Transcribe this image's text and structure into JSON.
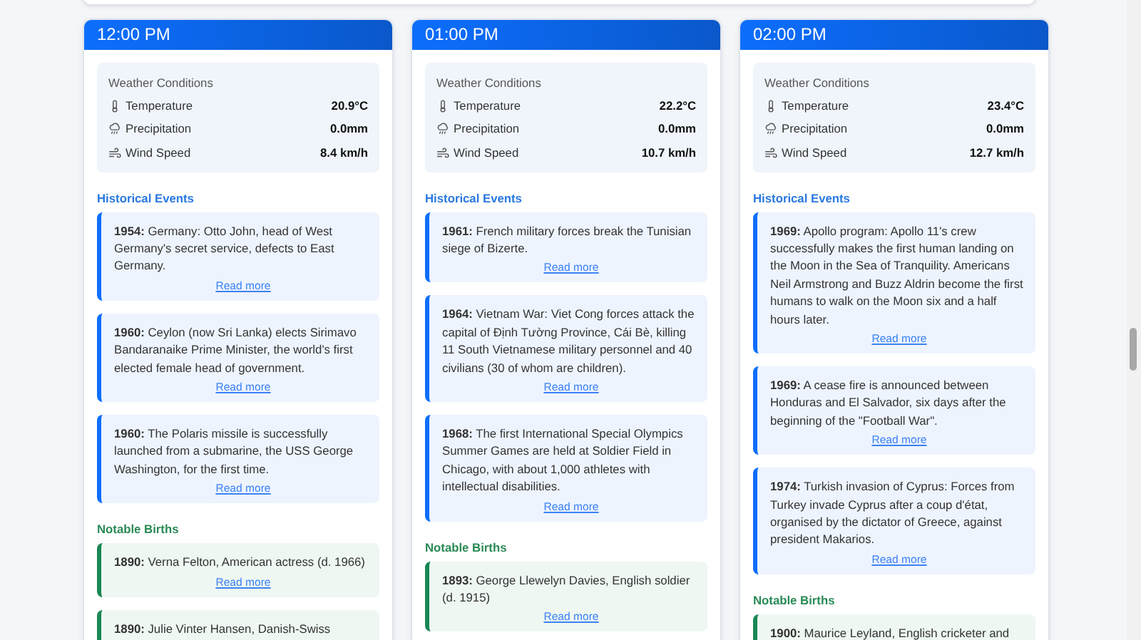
{
  "hours": [
    {
      "time": "12:00 PM",
      "weather": {
        "title": "Weather Conditions",
        "rows": [
          {
            "kind": "temperature",
            "label": "Temperature",
            "value": "20.9°C"
          },
          {
            "kind": "precipitation",
            "label": "Precipitation",
            "value": "0.0mm"
          },
          {
            "kind": "wind",
            "label": "Wind Speed",
            "value": "8.4 km/h"
          }
        ]
      },
      "sections": [
        {
          "kind": "events",
          "title": "Historical Events",
          "items": [
            {
              "text": "**1954:** Germany: Otto John, head of West Germany's secret service, defects to East Germany.",
              "link": "Read more"
            },
            {
              "text": "**1960:** Ceylon (now Sri Lanka) elects Sirimavo Bandaranaike Prime Minister, the world's first elected female head of government.",
              "link": "Read more"
            },
            {
              "text": "**1960:** The Polaris missile is successfully launched from a submarine, the USS George Washington, for the first time.",
              "link": "Read more"
            }
          ]
        },
        {
          "kind": "births",
          "title": "Notable Births",
          "items": [
            {
              "text": "**1890:** Verna Felton, American actress (d. 1966)",
              "link": "Read more"
            },
            {
              "text": "**1890:** Julie Vinter Hansen, Danish-Swiss"
            }
          ]
        }
      ]
    },
    {
      "time": "01:00 PM",
      "weather": {
        "title": "Weather Conditions",
        "rows": [
          {
            "kind": "temperature",
            "label": "Temperature",
            "value": "22.2°C"
          },
          {
            "kind": "precipitation",
            "label": "Precipitation",
            "value": "0.0mm"
          },
          {
            "kind": "wind",
            "label": "Wind Speed",
            "value": "10.7 km/h"
          }
        ]
      },
      "sections": [
        {
          "kind": "events",
          "title": "Historical Events",
          "items": [
            {
              "text": "**1961:** French military forces break the Tunisian siege of Bizerte.",
              "link": "Read more"
            },
            {
              "text": "**1964:** Vietnam War: Viet Cong forces attack the capital of Định Tường Province, Cái Bè, killing 11 South Vietnamese military personnel and 40 civilians (30 of whom are children).",
              "link": "Read more"
            },
            {
              "text": "**1968:** The first International Special Olympics Summer Games are held at Soldier Field in Chicago, with about 1,000 athletes with intellectual disabilities.",
              "link": "Read more"
            }
          ]
        },
        {
          "kind": "births",
          "title": "Notable Births",
          "items": [
            {
              "text": "**1893:** George Llewelyn Davies, English soldier (d. 1915)",
              "link": "Read more"
            }
          ]
        }
      ]
    },
    {
      "time": "02:00 PM",
      "weather": {
        "title": "Weather Conditions",
        "rows": [
          {
            "kind": "temperature",
            "label": "Temperature",
            "value": "23.4°C"
          },
          {
            "kind": "precipitation",
            "label": "Precipitation",
            "value": "0.0mm"
          },
          {
            "kind": "wind",
            "label": "Wind Speed",
            "value": "12.7 km/h"
          }
        ]
      },
      "sections": [
        {
          "kind": "events",
          "title": "Historical Events",
          "items": [
            {
              "text": "**1969:** Apollo program: Apollo 11's crew successfully makes the first human landing on the Moon in the Sea of Tranquility. Americans Neil Armstrong and Buzz Aldrin become the first humans to walk on the Moon six and a half hours later.",
              "link": "Read more"
            },
            {
              "text": "**1969:** A cease fire is announced between Honduras and El Salvador, six days after the beginning of the \"Football War\".",
              "link": "Read more"
            },
            {
              "text": "**1974:** Turkish invasion of Cyprus: Forces from Turkey invade Cyprus after a coup d'état, organised by the dictator of Greece, against president Makarios.",
              "link": "Read more"
            }
          ]
        },
        {
          "kind": "births",
          "title": "Notable Births",
          "items": [
            {
              "text": "**1900:** Maurice Leyland, English cricketer and"
            }
          ]
        }
      ]
    }
  ]
}
